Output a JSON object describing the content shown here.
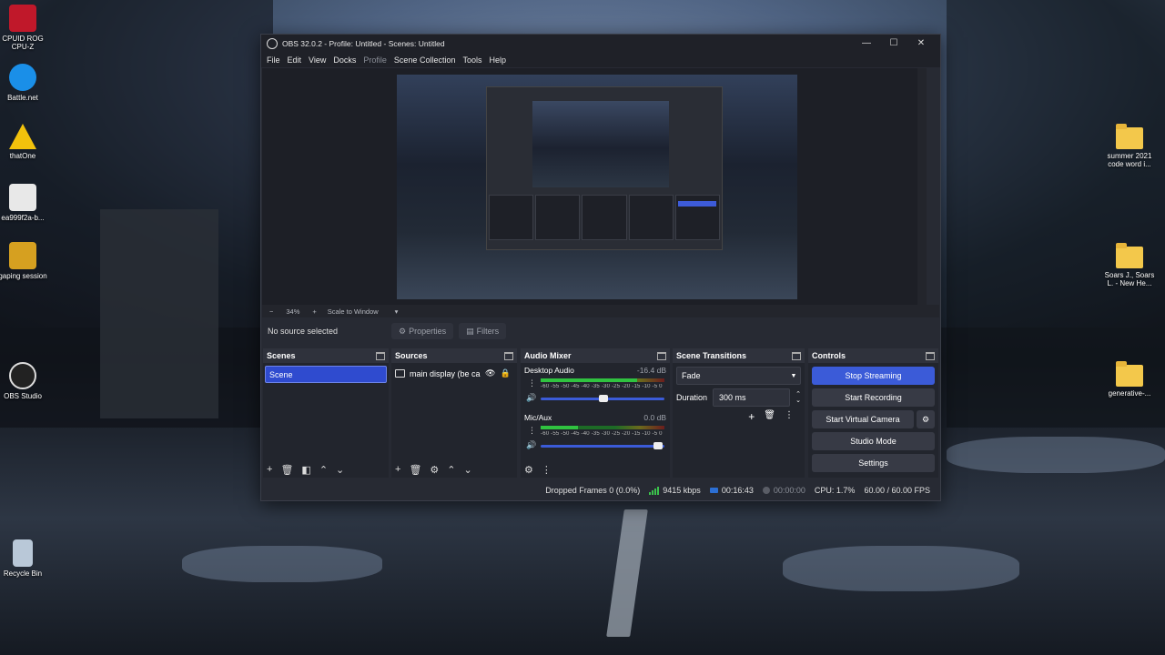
{
  "desktop": {
    "icons_left": [
      {
        "label": "CPUID ROG CPU-Z",
        "icon": "cpu-z-icon",
        "color": "#c0182a"
      },
      {
        "label": "Battle.net",
        "icon": "battlenet-icon",
        "color": "#1a8fe8"
      },
      {
        "label": "thatOne",
        "icon": "warning-icon",
        "color": "#f2c20c"
      },
      {
        "label": "ea999f2a-b...",
        "icon": "chrome-icon",
        "color": "#e0e0e0"
      },
      {
        "label": "gaping session",
        "icon": "shortcut-icon",
        "color": "#d6a020"
      },
      {
        "label": "OBS Studio",
        "icon": "obs-icon",
        "color": "#222222"
      },
      {
        "label": "Recycle Bin",
        "icon": "recycle-bin-icon",
        "color": "#b9c8d8"
      }
    ],
    "icons_right": [
      {
        "label": "summer 2021 code word i..."
      },
      {
        "label": "Soars J., Soars L. - New He..."
      },
      {
        "label": "generative-..."
      }
    ]
  },
  "window": {
    "title": "OBS 32.0.2 - Profile: Untitled - Scenes: Untitled",
    "controls": {
      "minimize": "—",
      "maximize": "☐",
      "close": "✕"
    },
    "menu": [
      "File",
      "Edit",
      "View",
      "Docks",
      "Profile",
      "Scene Collection",
      "Tools",
      "Help"
    ]
  },
  "preview": {
    "zoom_minus": "−",
    "zoom_value": "34%",
    "zoom_plus": "+",
    "scale_mode": "Scale to Window"
  },
  "source_bar": {
    "status": "No source selected",
    "properties": "Properties",
    "filters": "Filters"
  },
  "scenes": {
    "title": "Scenes",
    "items": [
      "Scene"
    ]
  },
  "sources": {
    "title": "Sources",
    "items": [
      "main display (be cai"
    ]
  },
  "audio_mixer": {
    "title": "Audio Mixer",
    "ticks": "-60 -55 -50 -45 -40 -35 -30 -25 -20 -15 -10 -5 0",
    "channels": [
      {
        "name": "Desktop Audio",
        "db": "-16.4 dB",
        "level": 0.78,
        "volume": 0.5
      },
      {
        "name": "Mic/Aux",
        "db": "0.0 dB",
        "level": 0.3,
        "volume": 0.95
      }
    ]
  },
  "transitions": {
    "title": "Scene Transitions",
    "selected": "Fade",
    "duration_label": "Duration",
    "duration_value": "300 ms"
  },
  "controls": {
    "title": "Controls",
    "stop_streaming": "Stop Streaming",
    "start_recording": "Start Recording",
    "start_virtual_camera": "Start Virtual Camera",
    "studio_mode": "Studio Mode",
    "settings": "Settings"
  },
  "status": {
    "dropped_frames": "Dropped Frames 0 (0.0%)",
    "bitrate": "9415 kbps",
    "stream_time": "00:16:43",
    "rec_time": "00:00:00",
    "cpu": "CPU: 1.7%",
    "fps": "60.00 / 60.00 FPS"
  },
  "colors": {
    "accent": "#3b5bd8",
    "window_bg": "#272a33",
    "dock_bg": "#22252d"
  }
}
